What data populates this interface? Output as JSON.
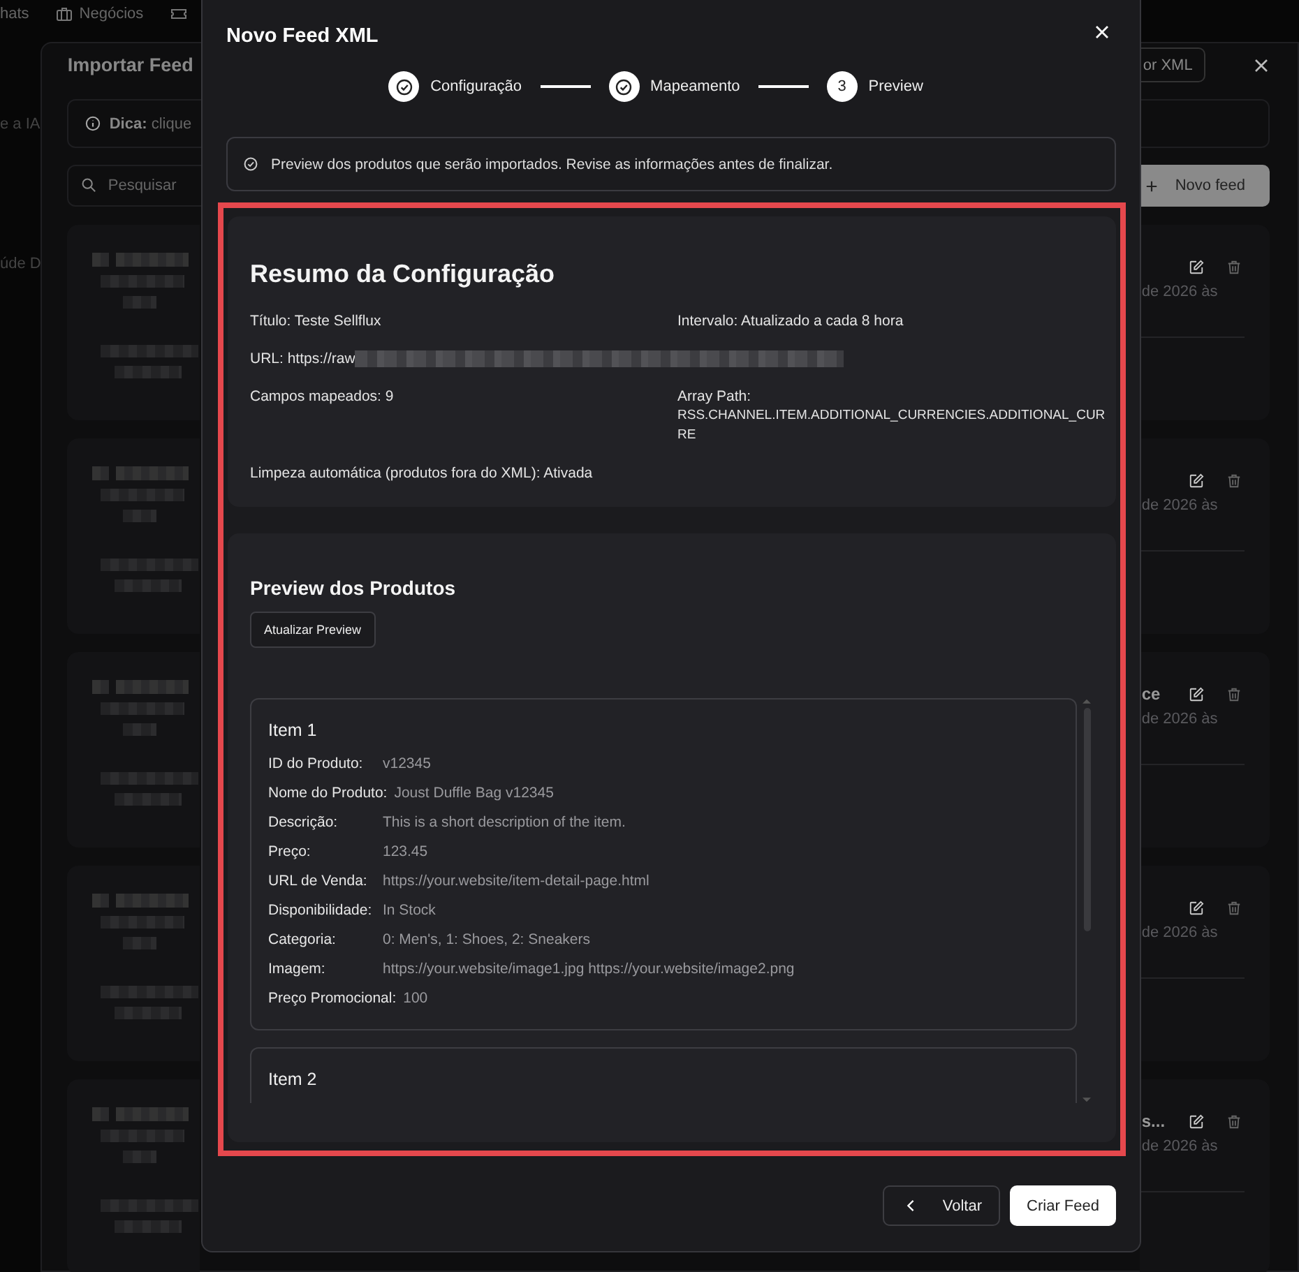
{
  "background": {
    "nav": [
      "hats",
      "Negócios"
    ],
    "sidebar_fragments": [
      "e a IA",
      "úde D"
    ],
    "panel": {
      "title": "Importar Feed",
      "import_button": "or XML",
      "tip": {
        "label": "Dica:",
        "text": "clique"
      },
      "search": {
        "placeholder": "Pesquisar"
      },
      "new_feed_button": "Novo feed",
      "cards": [
        {
          "date": "de 2026 às"
        },
        {
          "date": "de 2026 às"
        },
        {
          "title": "ce",
          "date": "de 2026 às"
        },
        {
          "date": "de 2026 às"
        },
        {
          "title": "s...",
          "date": "de 2026 às"
        }
      ]
    }
  },
  "dialog": {
    "title": "Novo Feed XML",
    "steps": [
      {
        "label": "Configuração",
        "done": true
      },
      {
        "label": "Mapeamento",
        "done": true
      },
      {
        "label": "Preview",
        "done": false,
        "number": "3"
      }
    ],
    "notice": "Preview dos produtos que serão importados. Revise as informações antes de finalizar.",
    "summary": {
      "title": "Resumo da Configuração",
      "fields": [
        {
          "kind": "text",
          "text": "Título: Teste Sellflux"
        },
        {
          "kind": "text",
          "text": "Intervalo: Atualizado a cada 8 hora"
        },
        {
          "kind": "redacted",
          "text": "URL: https://raw"
        },
        {
          "kind": "text",
          "text": "Campos mapeados: 9"
        },
        {
          "kind": "stacked",
          "text": "Array Path:",
          "value": "RSS.CHANNEL.ITEM.ADDITIONAL_CURRENCIES.ADDITIONAL_CURRE"
        },
        {
          "kind": "text",
          "text": "Limpeza automática (produtos fora do XML): Ativada"
        }
      ]
    },
    "preview": {
      "title": "Preview dos Produtos",
      "refresh_button": "Atualizar Preview",
      "items": [
        {
          "title": "Item 1",
          "fields": [
            {
              "label": "ID do Produto:",
              "value": "v12345"
            },
            {
              "label": "Nome do Produto:",
              "value": "Joust Duffle Bag v12345"
            },
            {
              "label": "Descrição:",
              "value": "This is a short description of the item."
            },
            {
              "label": "Preço:",
              "value": "123.45"
            },
            {
              "label": "URL de Venda:",
              "value": "https://your.website/item-detail-page.html"
            },
            {
              "label": "Disponibilidade:",
              "value": "In Stock"
            },
            {
              "label": "Categoria:",
              "value": "0: Men's, 1: Shoes, 2: Sneakers"
            },
            {
              "label": "Imagem:",
              "value": "https://your.website/image1.jpg https://your.website/image2.png"
            },
            {
              "label": "Preço Promocional:",
              "value": "100"
            }
          ]
        },
        {
          "title": "Item 2"
        }
      ]
    },
    "buttons": {
      "back": "Voltar",
      "create": "Criar Feed"
    }
  }
}
